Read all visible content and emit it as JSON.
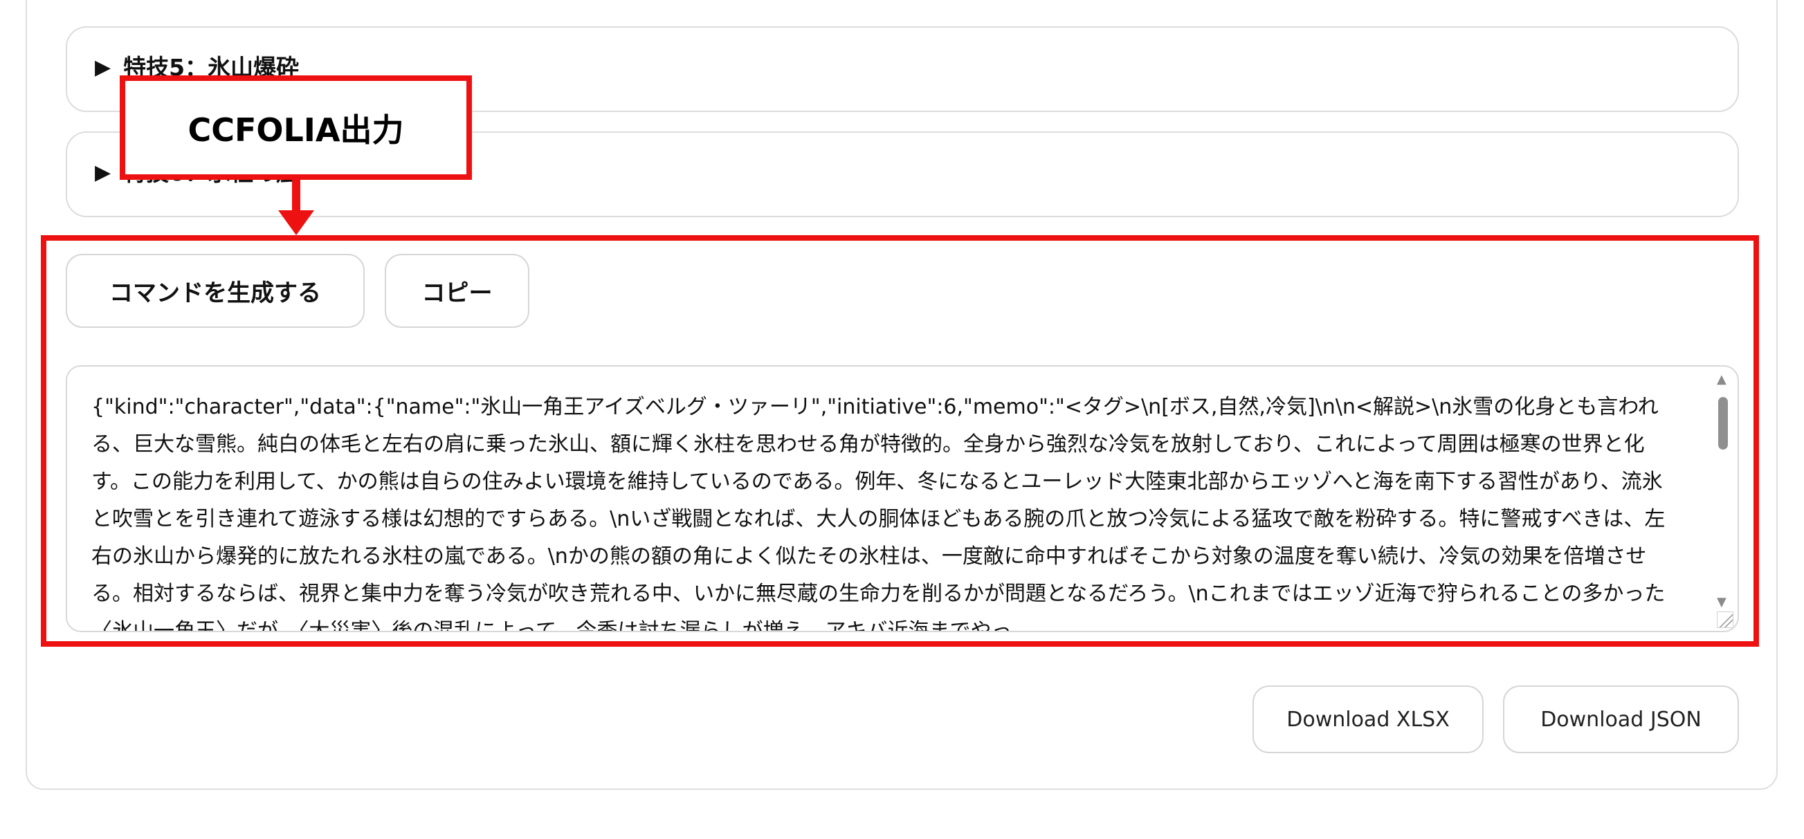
{
  "sections": [
    {
      "label": "特技5：氷山爆砕"
    },
    {
      "label": "特技6：氷柱の嵐"
    }
  ],
  "actions": {
    "generate_label": "コマンドを生成する",
    "copy_label": "コピー"
  },
  "output": {
    "value": "{\"kind\":\"character\",\"data\":{\"name\":\"氷山一角王アイズベルグ・ツァーリ\",\"initiative\":6,\"memo\":\"<タグ>\\n[ボス,自然,冷気]\\n\\n<解説>\\n氷雪の化身とも言われる、巨大な雪熊。純白の体毛と左右の肩に乗った氷山、額に輝く氷柱を思わせる角が特徴的。全身から強烈な冷気を放射しており、これによって周囲は極寒の世界と化す。この能力を利用して、かの熊は自らの住みよい環境を維持しているのである。例年、冬になるとユーレッド大陸東北部からエッゾへと海を南下する習性があり、流氷と吹雪とを引き連れて遊泳する様は幻想的ですらある。\\nいざ戦闘となれば、大人の胴体ほどもある腕の爪と放つ冷気による猛攻で敵を粉砕する。特に警戒すべきは、左右の氷山から爆発的に放たれる氷柱の嵐である。\\nかの熊の額の角によく似たその氷柱は、一度敵に命中すればそこから対象の温度を奪い続け、冷気の効果を倍増させる。相対するならば、視界と集中力を奪う冷気が吹き荒れる中、いかに無尽蔵の生命力を削るかが問題となるだろう。\\nこれまではエッゾ近海で狩られることの多かった〈氷山一角王〉だが、〈大災害〉後の混乱によって、今季は討ち漏らしが増え、アキバ近海までやっ"
  },
  "downloads": {
    "xlsx_label": "Download XLSX",
    "json_label": "Download JSON"
  },
  "annotation": {
    "label": "CCFOLIA出力",
    "color": "#ee1111"
  },
  "icons": {
    "disclosure": "▶",
    "scroll_up": "▲",
    "scroll_down": "▼"
  }
}
